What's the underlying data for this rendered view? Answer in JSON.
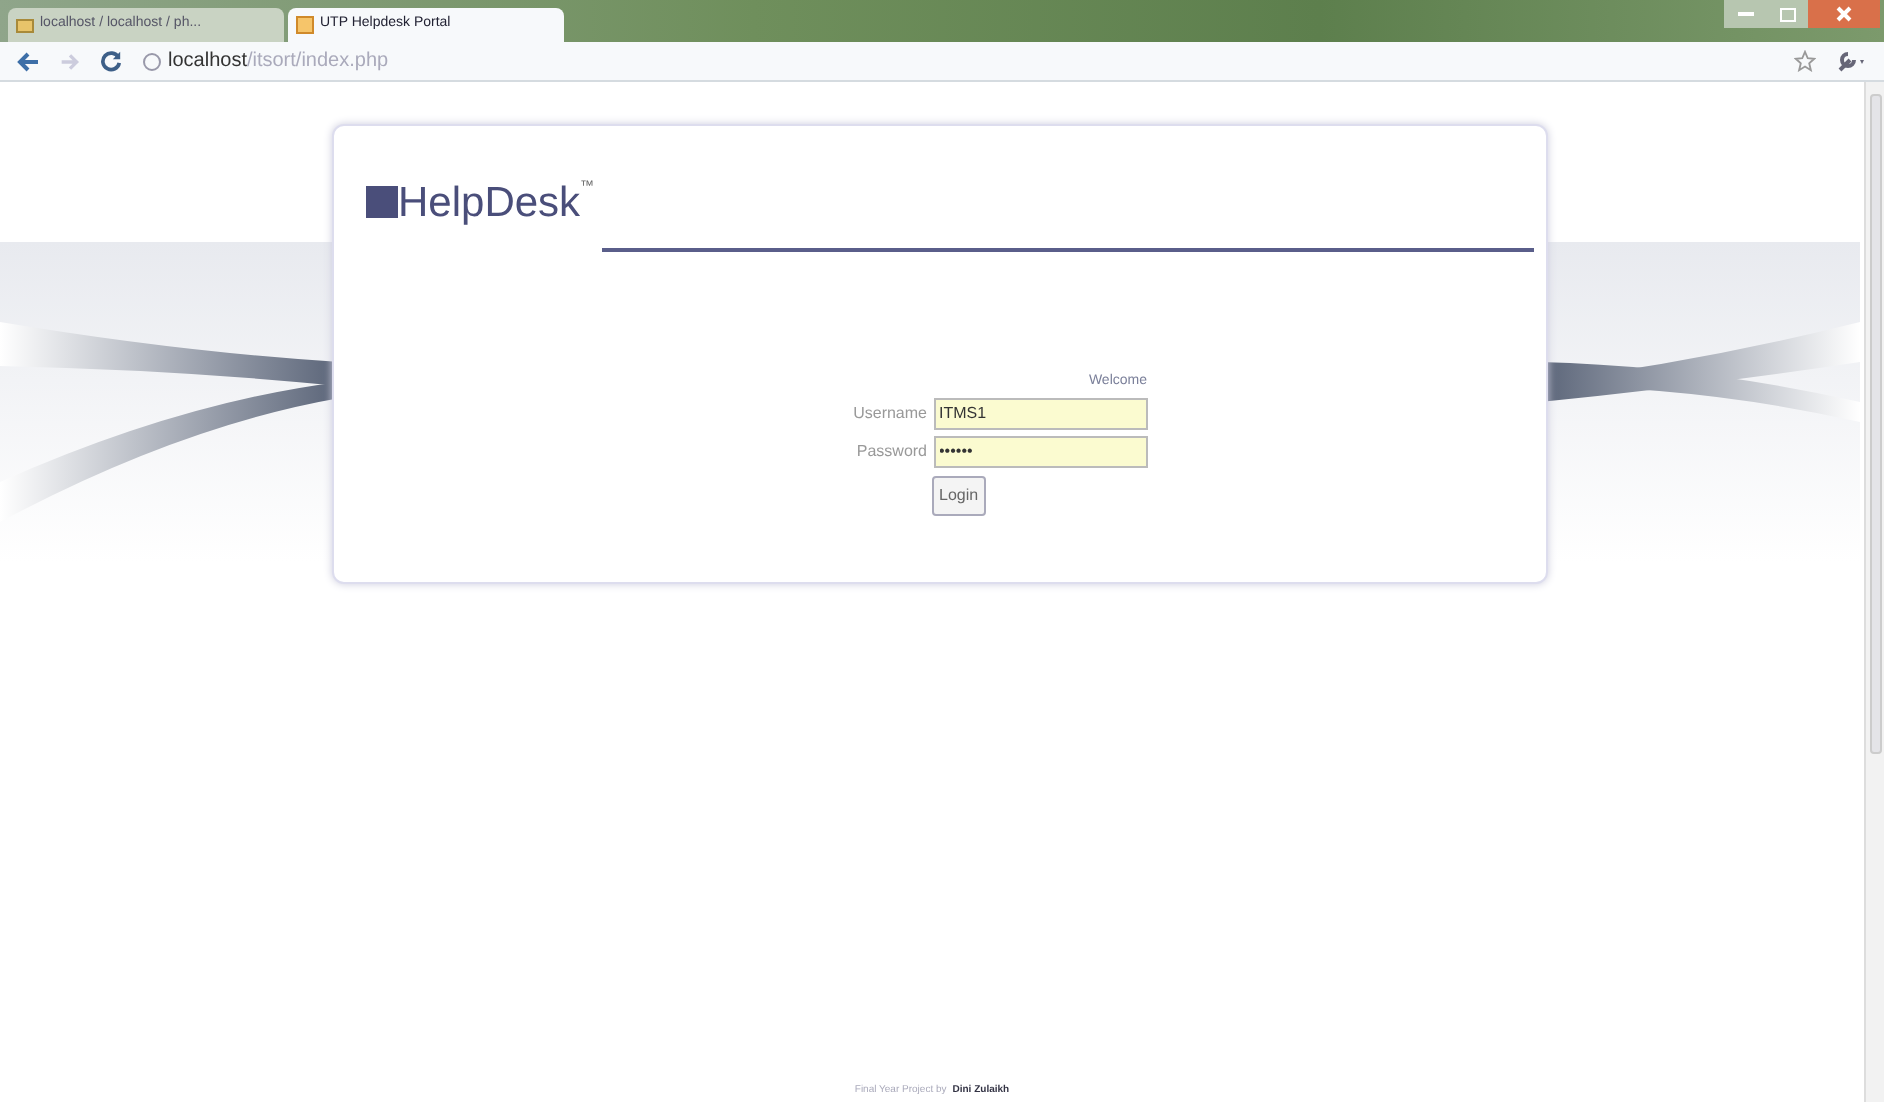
{
  "browser": {
    "tabs": [
      {
        "title": "localhost / localhost / ph...",
        "selected": false
      },
      {
        "title": "UTP Helpdesk Portal",
        "selected": true
      }
    ],
    "address": {
      "host": "localhost",
      "path": "/itsort/index.php"
    }
  },
  "page": {
    "logo": "HelpDesk",
    "trademark": "™",
    "form": {
      "heading": "Welcome",
      "fields": [
        {
          "label": "Username",
          "value": "ITMS1"
        },
        {
          "label": "Password",
          "value": "••••••"
        }
      ],
      "button": "Login"
    },
    "footer": {
      "text": "Final Year Project by",
      "author": "Dini Zulaikh"
    }
  }
}
